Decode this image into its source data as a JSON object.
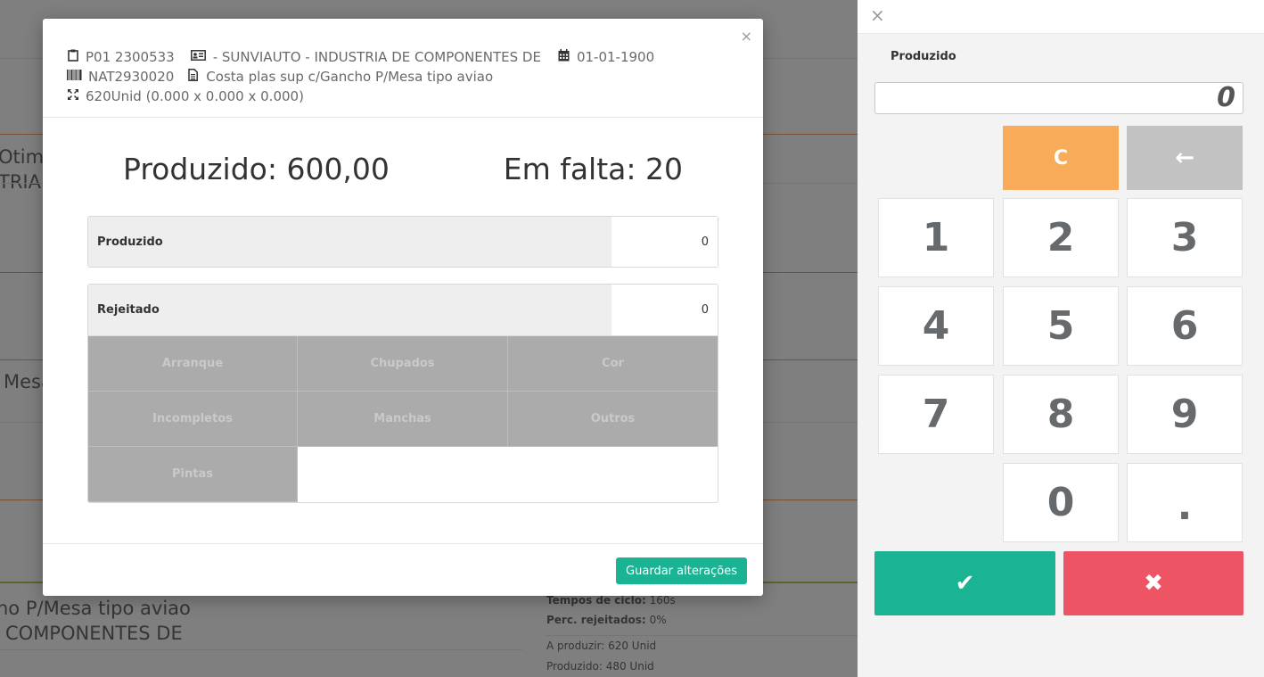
{
  "background": {
    "row1_line1": "Otimiz",
    "row1_line2": "TRIA D",
    "row2": "Mesa",
    "product_line1": "no P/Mesa tipo aviao",
    "product_line2": "COMPONENTES DE",
    "cycle_label": "Tempos de ciclo:",
    "cycle_value": "160s",
    "reject_label": "Perc. rejeitados:",
    "reject_value": "0%",
    "to_produce": "A produzir: 620 Unid",
    "produced": "Produzido: 480 Unid"
  },
  "modal": {
    "close_label": "×",
    "order": "P01 2300533",
    "client": "- SUNVIAUTO - INDUSTRIA DE COMPONENTES DE",
    "date": "01-01-1900",
    "product_code": "NAT2930020",
    "product_desc": "Costa plas sup c/Gancho P/Mesa tipo aviao",
    "quantity": "620Unid (0.000 x 0.000 x 0.000)",
    "produced_summary": "Produzido: 600,00",
    "missing_summary": "Em falta: 20",
    "produced_field": {
      "label": "Produzido",
      "value": "0"
    },
    "rejected_field": {
      "label": "Rejeitado",
      "value": "0"
    },
    "reasons": [
      "Arranque",
      "Chupados",
      "Cor",
      "Incompletos",
      "Manchas",
      "Outros",
      "Pintas"
    ],
    "save_label": "Guardar alterações"
  },
  "keypad": {
    "close_label": "×",
    "title": "Produzido",
    "display_value": "0",
    "clear_label": "C",
    "backspace_label": "←",
    "keys": [
      "1",
      "2",
      "3",
      "4",
      "5",
      "6",
      "7",
      "8",
      "9",
      "0",
      "."
    ],
    "confirm_label": "✔",
    "cancel_label": "✖"
  },
  "colors": {
    "accent_green": "#1ab394",
    "danger_red": "#ed5565",
    "warning_orange": "#f8ac59",
    "backspace_gray": "#c2c2c2"
  }
}
